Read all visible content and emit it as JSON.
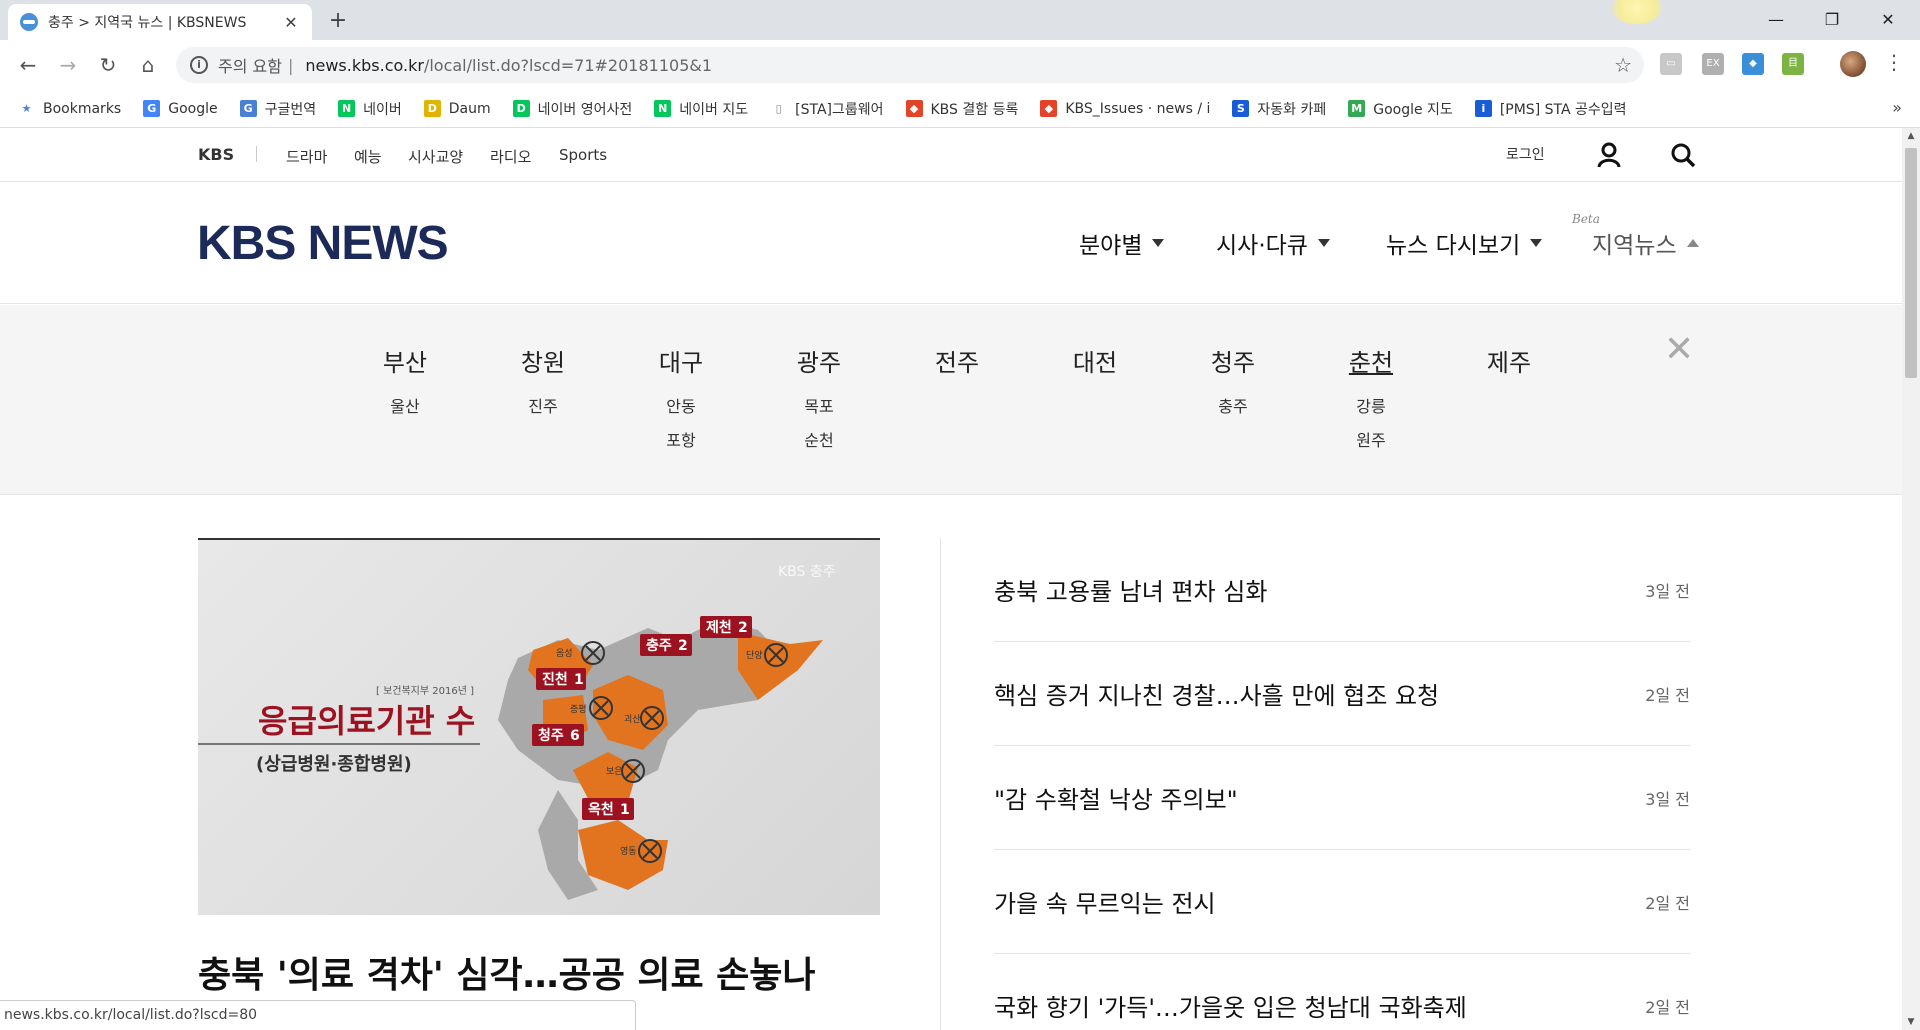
{
  "browser": {
    "tab_title": "충주 > 지역국 뉴스 | KBSNEWS",
    "tab_close": "✕",
    "new_tab": "+",
    "window": {
      "minimize": "—",
      "restore": "❐",
      "close": "✕"
    },
    "nav": {
      "back": "←",
      "forward": "→",
      "reload": "↻",
      "home": "⌂"
    },
    "omnibox": {
      "info": "i",
      "warning": "주의 요함",
      "separator": "|",
      "url_host": "news.kbs.co.kr",
      "url_path": "/local/list.do?lscd=71#20181105&1"
    },
    "star": "☆",
    "kebab": "⋮",
    "extensions": [
      {
        "label": "▭",
        "color": "#c8c8c8"
      },
      {
        "label": "EX",
        "color": "#b0b0b0"
      },
      {
        "label": "◆",
        "color": "#3b8fd9"
      },
      {
        "label": "目",
        "color": "#7cb342"
      }
    ],
    "bookmarks": [
      {
        "label": "Bookmarks",
        "icon": "star-icon",
        "glyph": "★",
        "color": "#4a7fd6"
      },
      {
        "label": "Google",
        "icon": "google-icon",
        "glyph": "G",
        "color": "#4285f4"
      },
      {
        "label": "구글번역",
        "icon": "translate-icon",
        "glyph": "G",
        "color": "#4a7fd6"
      },
      {
        "label": "네이버",
        "icon": "naver-icon",
        "glyph": "N",
        "color": "#03c75a"
      },
      {
        "label": "Daum",
        "icon": "daum-icon",
        "glyph": "D",
        "color": "#e0b400"
      },
      {
        "label": "네이버 영어사전",
        "icon": "naver-dict-icon",
        "glyph": "D",
        "color": "#03c75a"
      },
      {
        "label": "네이버 지도",
        "icon": "naver-map-icon",
        "glyph": "N",
        "color": "#03c75a"
      },
      {
        "label": "[STA]그룹웨어",
        "icon": "page-icon",
        "glyph": "▯",
        "color": "#888888"
      },
      {
        "label": "KBS 결함 등록",
        "icon": "gitlab-icon",
        "glyph": "◆",
        "color": "#e24329"
      },
      {
        "label": "KBS_Issues · news / i",
        "icon": "gitlab-icon",
        "glyph": "◆",
        "color": "#e24329"
      },
      {
        "label": "자동화 카페",
        "icon": "cafe-icon",
        "glyph": "S",
        "color": "#1a5bd6"
      },
      {
        "label": "Google 지도",
        "icon": "maps-icon",
        "glyph": "M",
        "color": "#34a853"
      },
      {
        "label": "[PMS] STA 공수입력",
        "icon": "pms-icon",
        "glyph": "i",
        "color": "#1a5bd6"
      }
    ],
    "bookmarks_more": "»",
    "status_url": "news.kbs.co.kr/local/list.do?lscd=80"
  },
  "gnb": {
    "brand": "KBS",
    "links": [
      "드라마",
      "예능",
      "시사교양",
      "라디오",
      "Sports"
    ],
    "login": "로그인"
  },
  "header": {
    "logo": "KBS NEWS",
    "nav": [
      "분야별",
      "시사·다큐",
      "뉴스 다시보기",
      "지역뉴스"
    ],
    "beta": "Beta"
  },
  "regions": [
    {
      "name": "부산",
      "subs": [
        "울산"
      ]
    },
    {
      "name": "창원",
      "subs": [
        "진주"
      ]
    },
    {
      "name": "대구",
      "subs": [
        "안동",
        "포항"
      ]
    },
    {
      "name": "광주",
      "subs": [
        "목포",
        "순천"
      ]
    },
    {
      "name": "전주",
      "subs": []
    },
    {
      "name": "대전",
      "subs": []
    },
    {
      "name": "청주",
      "subs": [
        "충주"
      ]
    },
    {
      "name": "춘천",
      "subs": [
        "강릉",
        "원주"
      ]
    },
    {
      "name": "제주",
      "subs": []
    }
  ],
  "regions_close": "✕",
  "featured": {
    "image": {
      "watermark": "KBS 충주",
      "source": "[ 보건복지부 2016년 ]",
      "heading": "응급의료기관 수",
      "subheading": "(상급병원·종합병원)",
      "map_labels": [
        {
          "name": "진천",
          "count": "1"
        },
        {
          "name": "충주",
          "count": "2"
        },
        {
          "name": "제천",
          "count": "2"
        },
        {
          "name": "청주",
          "count": "6"
        },
        {
          "name": "옥천",
          "count": "1"
        }
      ],
      "map_small_labels": [
        "음성",
        "단양",
        "증평",
        "괴산",
        "보은",
        "영동"
      ]
    },
    "title": "충북 '의료 격차' 심각…공공 의료 손놓나"
  },
  "news": [
    {
      "title": "충북 고용률 남녀 편차 심화",
      "time": "3일 전"
    },
    {
      "title": "핵심 증거 지나친 경찰…사흘 만에 협조 요청",
      "time": "2일 전"
    },
    {
      "title": "\"감 수확철 낙상 주의보\"",
      "time": "3일 전"
    },
    {
      "title": "가을 속 무르익는 전시",
      "time": "2일 전"
    },
    {
      "title": "국화 향기 '가득'…가을옷 입은 청남대 국화축제",
      "time": "2일 전"
    }
  ]
}
